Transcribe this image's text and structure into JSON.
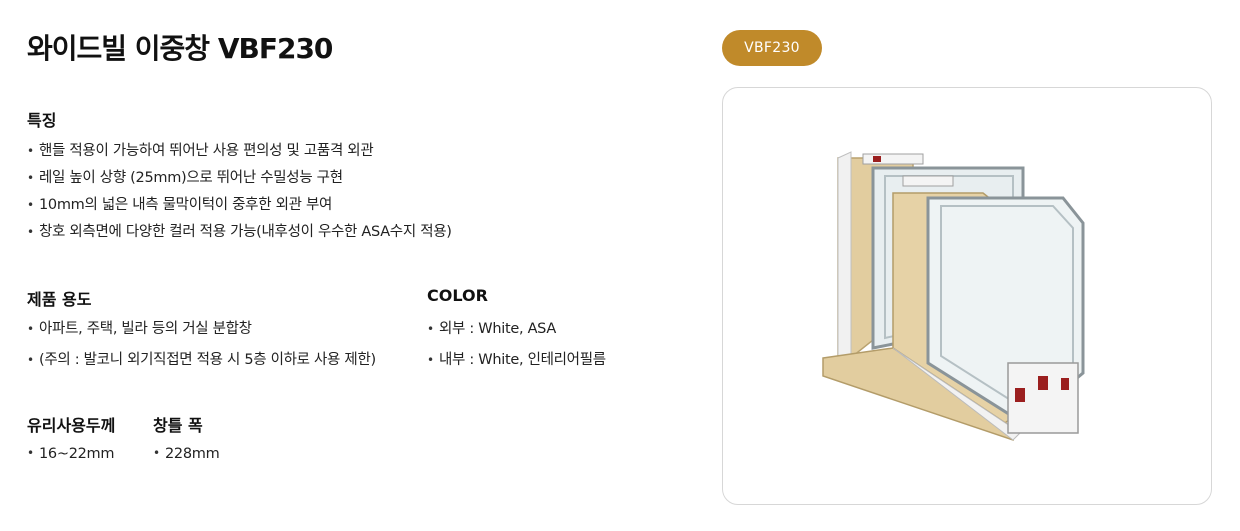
{
  "title": "와이드빌 이중창 VBF230",
  "badge": "VBF230",
  "features": {
    "title": "특징",
    "items": [
      "핸들 적용이 가능하여 뛰어난 사용 편의성 및 고품격 외관",
      "레일 높이 상향 (25mm)으로 뛰어난 수밀성능 구현",
      "10mm의 넓은 내측 물막이턱이 중후한 외관 부여",
      "창호 외측면에 다양한 컬러 적용 가능(내후성이 우수한 ASA수지 적용)"
    ]
  },
  "usage": {
    "title": "제품 용도",
    "items": [
      "아파트, 주택, 빌라 등의 거실 분합창",
      "(주의 : 발코니 외기직접면 적용 시 5층 이하로 사용 제한)"
    ]
  },
  "color": {
    "title": "COLOR",
    "items": [
      "외부 : White, ASA",
      "내부 : White, 인테리어필름"
    ]
  },
  "glass": {
    "title": "유리사용두께",
    "items": [
      "16~22mm"
    ]
  },
  "frame": {
    "title": "창틀 폭",
    "items": [
      "228mm"
    ]
  },
  "colors": {
    "accent": "#c08a2a",
    "wood": "#e2cd9f",
    "pvc": "#f2f2f2",
    "seal": "#9b1f1f",
    "glass": "#c9d2d6"
  }
}
